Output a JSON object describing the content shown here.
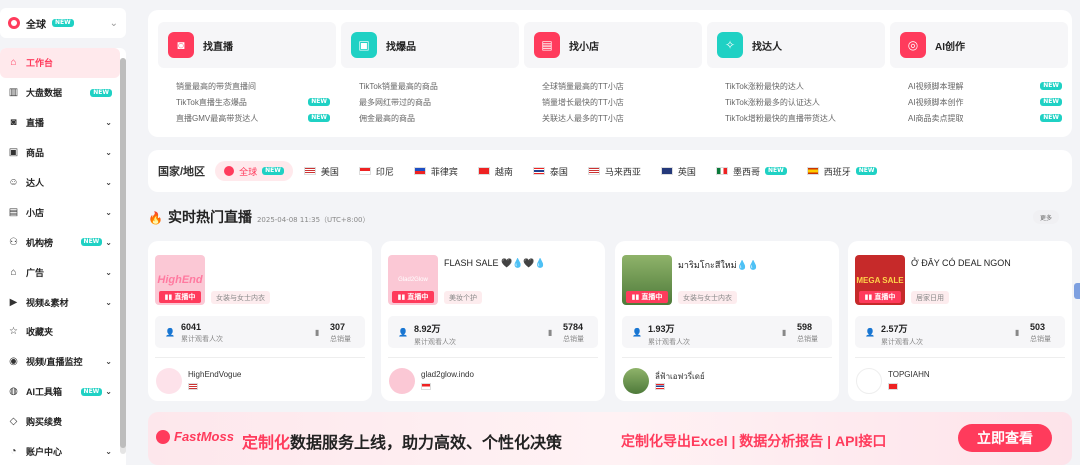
{
  "region_select": {
    "label": "全球",
    "badge": "NEW"
  },
  "sidebar": {
    "items": [
      {
        "label": "工作台",
        "icon": "home-icon",
        "active": true
      },
      {
        "label": "大盘数据",
        "icon": "chart-icon",
        "badge": "NEW"
      },
      {
        "label": "直播",
        "icon": "camera-icon",
        "expand": true
      },
      {
        "label": "商品",
        "icon": "box-icon",
        "expand": true
      },
      {
        "label": "达人",
        "icon": "user-icon",
        "expand": true
      },
      {
        "label": "小店",
        "icon": "shop-icon",
        "expand": true
      },
      {
        "label": "机构榜",
        "icon": "org-icon",
        "badge": "NEW",
        "expand": true
      },
      {
        "label": "广告",
        "icon": "ad-icon",
        "expand": true
      },
      {
        "label": "视频&素材",
        "icon": "video-icon",
        "expand": true
      },
      {
        "label": "收藏夹",
        "icon": "star-icon"
      },
      {
        "label": "视频/直播监控",
        "icon": "monitor-icon",
        "expand": true
      },
      {
        "label": "AI工具箱",
        "icon": "ai-icon",
        "badge": "NEW",
        "expand": true
      },
      {
        "label": "购买续费",
        "icon": "diamond-icon"
      },
      {
        "label": "账户中心",
        "icon": "account-icon",
        "expand": true
      }
    ]
  },
  "categories": [
    {
      "title": "找直播",
      "icon": "live-icon",
      "color": "#ff3b5c",
      "links": [
        {
          "text": "销量最高的带货直播间"
        },
        {
          "text": "TikTok直播生态爆品",
          "badge": "NEW"
        },
        {
          "text": "直播GMV最高带货达人",
          "badge": "NEW"
        }
      ]
    },
    {
      "title": "找爆品",
      "icon": "product-icon",
      "color": "#1fd1c4",
      "links": [
        {
          "text": "TikTok销量最高的商品"
        },
        {
          "text": "最多网红带过的商品"
        },
        {
          "text": "佣金最高的商品"
        }
      ]
    },
    {
      "title": "找小店",
      "icon": "store-icon",
      "color": "#ff3b5c",
      "links": [
        {
          "text": "全球销量最高的TT小店"
        },
        {
          "text": "销量增长最快的TT小店"
        },
        {
          "text": "关联达人最多的TT小店"
        }
      ]
    },
    {
      "title": "找达人",
      "icon": "influencer-icon",
      "color": "#1fd1c4",
      "links": [
        {
          "text": "TikTok涨粉最快的达人"
        },
        {
          "text": "TikTok涨粉最多的认证达人"
        },
        {
          "text": "TikTok增粉最快的直播带货达人"
        }
      ]
    },
    {
      "title": "AI创作",
      "icon": "ai-create-icon",
      "color": "#ff3b5c",
      "links": [
        {
          "text": "AI视频脚本理解",
          "badge": "NEW"
        },
        {
          "text": "AI视频脚本创作",
          "badge": "NEW"
        },
        {
          "text": "AI商品卖点提取",
          "badge": "NEW"
        }
      ]
    }
  ],
  "country_bar": {
    "title": "国家/地区",
    "countries": [
      {
        "name": "全球",
        "flag": "globe",
        "active": true,
        "badge": "NEW"
      },
      {
        "name": "美国",
        "flag": "us"
      },
      {
        "name": "印尼",
        "flag": "id"
      },
      {
        "name": "菲律宾",
        "flag": "ph"
      },
      {
        "name": "越南",
        "flag": "vn"
      },
      {
        "name": "泰国",
        "flag": "th"
      },
      {
        "name": "马来西亚",
        "flag": "my"
      },
      {
        "name": "英国",
        "flag": "gb"
      },
      {
        "name": "墨西哥",
        "flag": "mx",
        "badge": "NEW"
      },
      {
        "name": "西班牙",
        "flag": "es",
        "badge": "NEW"
      }
    ]
  },
  "live_section": {
    "title": "实时热门直播",
    "datetime": "2025-04-08 11:35（UTC+8:00）",
    "more": "更多",
    "cards": [
      {
        "title": "",
        "thumb_text": "HighEnd",
        "live_label": "直播中",
        "category": "女装与女士内衣",
        "viewers": "6041",
        "viewers_label": "累计观看人次",
        "sales": "307",
        "sales_label": "总销量",
        "shop": "HighEndVogue",
        "shop_flag": "us"
      },
      {
        "title": "FLASH SALE 🖤💧🖤💧",
        "thumb_text": "Glad2Glow",
        "live_label": "直播中",
        "category": "美妆个护",
        "viewers": "8.92万",
        "viewers_label": "累计观看人次",
        "sales": "5784",
        "sales_label": "总销量",
        "shop": "glad2glow.indo",
        "shop_flag": "id"
      },
      {
        "title": "มาริมโกะสีใหม่💧💧",
        "thumb_text": "",
        "live_label": "直播中",
        "category": "女装与女士内衣",
        "viewers": "1.93万",
        "viewers_label": "累计观看人次",
        "sales": "598",
        "sales_label": "总销量",
        "shop": "ลี่ฟ้าเอฟวรี่เดย์",
        "shop_flag": "th"
      },
      {
        "title": "Ở ĐÂY CÓ DEAL NGON",
        "thumb_text": "MEGA SALE",
        "live_label": "直播中",
        "category": "居家日用",
        "viewers": "2.57万",
        "viewers_label": "累计观看人次",
        "sales": "503",
        "sales_label": "总销量",
        "shop": "TOPGIAHN",
        "shop_flag": "vn"
      }
    ]
  },
  "banner": {
    "logo": "FastMoss",
    "headline_highlight": "定制化",
    "headline_rest": "数据服务上线，助力高效、个性化决策",
    "sub": "定制化导出Excel | 数据分析报告 | API接口",
    "cta": "立即查看"
  }
}
